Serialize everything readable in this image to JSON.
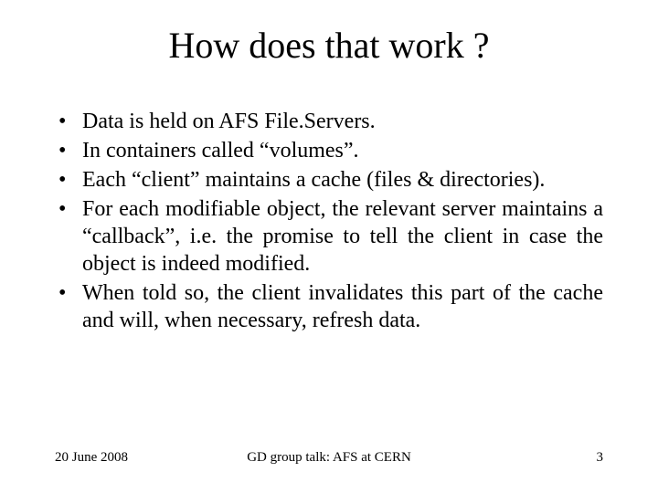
{
  "title": "How does that work ?",
  "bullets": [
    "Data is held on AFS File.Servers.",
    "In containers called “volumes”.",
    "Each “client” maintains a cache (files & directories).",
    "For each modifiable object, the relevant server maintains a “callback”, i.e. the promise to tell the client in case the object is indeed modified.",
    "When told so, the client invalidates this part of the cache and will, when necessary, refresh data."
  ],
  "footer": {
    "date": "20 June 2008",
    "center": "GD group talk: AFS at CERN",
    "page": "3"
  }
}
